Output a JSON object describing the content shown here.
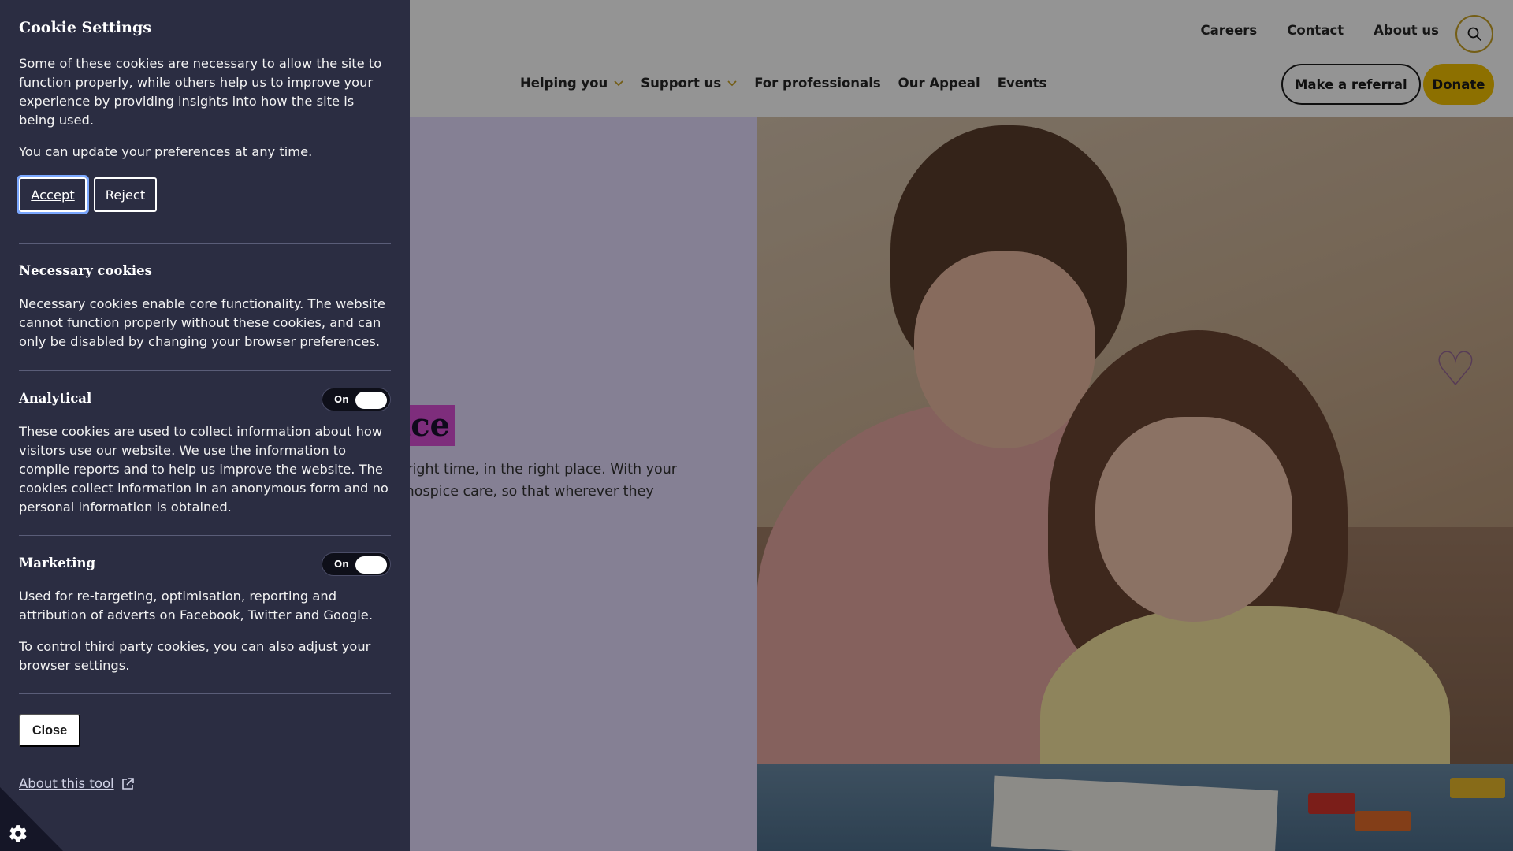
{
  "header": {
    "utility_nav": [
      "Careers",
      "Contact",
      "About us"
    ],
    "main_nav": [
      {
        "label": "Helping you",
        "has_submenu": true
      },
      {
        "label": "Support us",
        "has_submenu": true
      },
      {
        "label": "For professionals",
        "has_submenu": false
      },
      {
        "label": "Our Appeal",
        "has_submenu": false
      },
      {
        "label": "Events",
        "has_submenu": false
      }
    ],
    "referral_label": "Make a referral",
    "donate_label": "Donate",
    "search_icon": "search-icon"
  },
  "hero": {
    "title_visible": "ice",
    "text_visible": "e right time, in the right place. With your s hospice care, so that wherever they"
  },
  "cookie": {
    "title": "Cookie Settings",
    "intro": "Some of these cookies are necessary to allow the site to function properly, while others help us to improve your experience by providing insights into how the site is being used.",
    "update_note": "You can update your preferences at any time.",
    "accept_label": "Accept",
    "reject_label": "Reject",
    "necessary": {
      "heading": "Necessary cookies",
      "description": "Necessary cookies enable core functionality. The website cannot function properly without these cookies, and can only be disabled by changing your browser preferences."
    },
    "analytical": {
      "heading": "Analytical",
      "toggle_label": "On",
      "description": "These cookies are used to collect information about how visitors use our website. We use the information to compile reports and to help us improve the website. The cookies collect information in an anonymous form and no personal information is obtained."
    },
    "marketing": {
      "heading": "Marketing",
      "toggle_label": "On",
      "description": "Used for re-targeting, optimisation, reporting and attribution of adverts on Facebook, Twitter and Google.",
      "third_party_note": "To control third party cookies, you can also adjust your browser settings."
    },
    "close_label": "Close",
    "about_link": "About this tool"
  },
  "colors": {
    "panel_bg": "#2b2d42",
    "accent_yellow": "#f3c200",
    "hero_lilac": "#e6dcff",
    "title_highlight": "#d94fd6"
  }
}
